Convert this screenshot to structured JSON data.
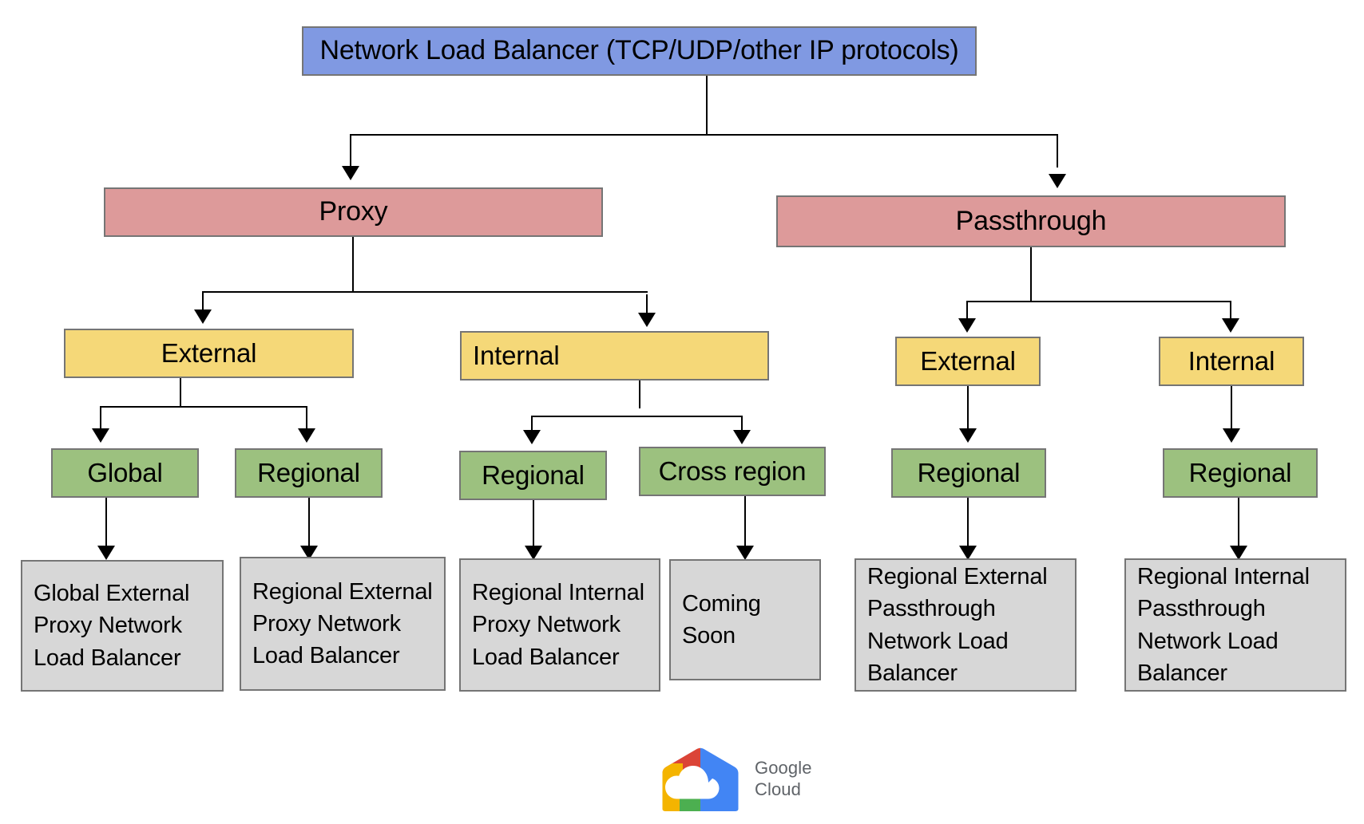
{
  "diagram": {
    "title": "Network Load Balancer (TCP/UDP/other IP protocols)",
    "root": {
      "label": "Network Load Balancer (TCP/UDP/other IP protocols)"
    },
    "categories": [
      {
        "label": "Proxy"
      },
      {
        "label": "Passthrough"
      }
    ],
    "scopes": [
      {
        "label": "External"
      },
      {
        "label": "Internal"
      },
      {
        "label": "External"
      },
      {
        "label": "Internal"
      }
    ],
    "reaches": [
      {
        "label": "Global"
      },
      {
        "label": "Regional"
      },
      {
        "label": "Regional"
      },
      {
        "label": "Cross  region"
      },
      {
        "label": "Regional"
      },
      {
        "label": "Regional"
      }
    ],
    "products": [
      {
        "label": "Global External Proxy Network Load Balancer"
      },
      {
        "label": "Regional External Proxy Network Load Balancer"
      },
      {
        "label": "Regional Internal  Proxy Network Load Balancer"
      },
      {
        "label": "Coming Soon"
      },
      {
        "label": "Regional External Passthrough Network Load Balancer"
      },
      {
        "label": "Regional Internal Passthrough Network Load Balancer"
      }
    ]
  },
  "branding": {
    "line1": "Google",
    "line2": "Cloud",
    "logo_icon": "google-cloud-logo-icon"
  },
  "colors": {
    "root_fill": "#8099e2",
    "category_fill": "#dd9a9a",
    "scope_fill": "#f5d878",
    "reach_fill": "#9cc17f",
    "product_fill": "#d7d7d7",
    "border": "#757575",
    "connector": "#000000",
    "google_red": "#db4437",
    "google_yellow": "#f4b400",
    "google_green": "#4caf50",
    "google_blue": "#4285f4"
  }
}
